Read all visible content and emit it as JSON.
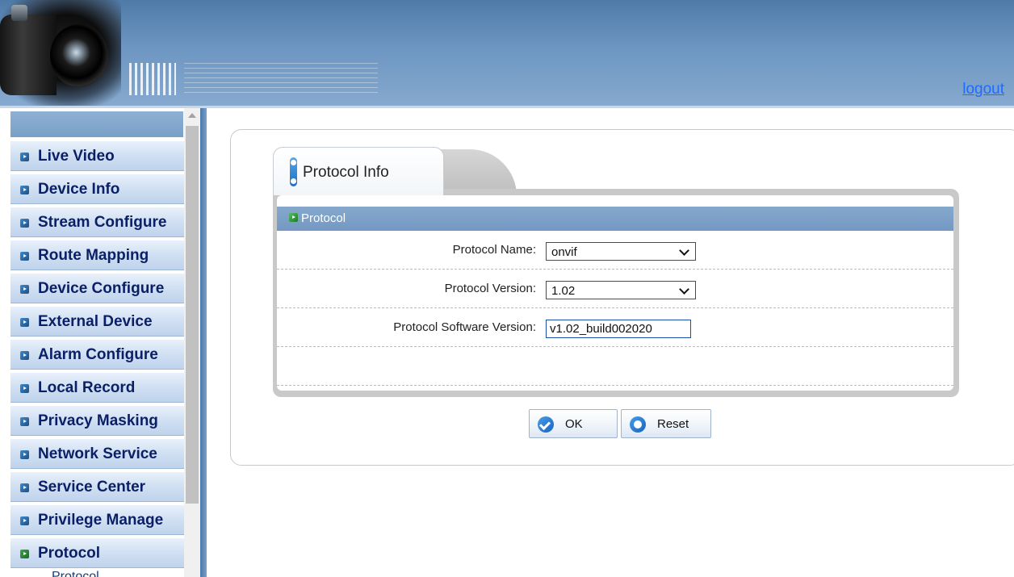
{
  "header": {
    "logout_label": "logout"
  },
  "sidebar": {
    "items": [
      {
        "label": "Live Video"
      },
      {
        "label": "Device Info"
      },
      {
        "label": "Stream Configure"
      },
      {
        "label": "Route Mapping"
      },
      {
        "label": "Device Configure"
      },
      {
        "label": "External Device"
      },
      {
        "label": "Alarm Configure"
      },
      {
        "label": "Local Record"
      },
      {
        "label": "Privacy Masking"
      },
      {
        "label": "Network Service"
      },
      {
        "label": "Service Center"
      },
      {
        "label": "Privilege Manage"
      },
      {
        "label": "Protocol"
      }
    ],
    "active_item": "Protocol",
    "sub_item": "Protocol"
  },
  "main": {
    "tab_title": "Protocol Info",
    "section_title": "Protocol",
    "fields": {
      "protocol_name": {
        "label": "Protocol Name:",
        "value": "onvif"
      },
      "protocol_version": {
        "label": "Protocol Version:",
        "value": "1.02"
      },
      "software_version": {
        "label": "Protocol Software Version:",
        "value": "v1.02_build002020"
      }
    },
    "buttons": {
      "ok_label": "OK",
      "reset_label": "Reset"
    }
  },
  "colors": {
    "header_blue": "#6d96c2",
    "nav_text": "#0b1f66",
    "section_bar": "#7a9ec6",
    "logout_link": "#1e6bff"
  }
}
